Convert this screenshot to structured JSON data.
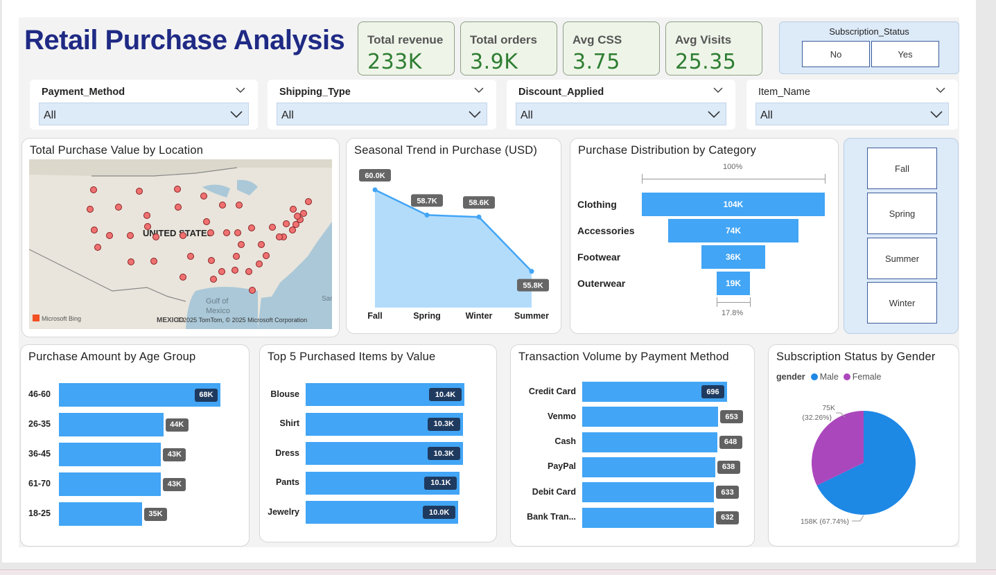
{
  "title": "Retail Purchase Analysis",
  "kpis": [
    {
      "label": "Total revenue",
      "value": "233K"
    },
    {
      "label": "Total orders",
      "value": "3.9K"
    },
    {
      "label": "Avg CSS",
      "value": "3.75"
    },
    {
      "label": "Avg Visits",
      "value": "25.35"
    }
  ],
  "subscription_slicer": {
    "header": "Subscription_Status",
    "options": [
      "No",
      "Yes"
    ]
  },
  "filters": [
    {
      "label": "Payment_Method",
      "value": "All",
      "bold": true
    },
    {
      "label": "Shipping_Type",
      "value": "All",
      "bold": true
    },
    {
      "label": "Discount_Applied",
      "value": "All",
      "bold": true
    },
    {
      "label": "Item_Name",
      "value": "All",
      "bold": false
    }
  ],
  "map": {
    "title": "Total Purchase Value by Location",
    "country_label": "UNITED STATES",
    "gulf_label": "Gulf of Mexico",
    "mexico_label": "MEXICO",
    "san_label": "Sar",
    "attribution": "© 2025 TomTom, © 2025 Microsoft Corporation",
    "bing_label": "Microsoft Bing",
    "colors": {
      "land": "#e9e5dc",
      "water": "#aac8d8",
      "marker": "#ef7171"
    }
  },
  "season_slicer": {
    "options": [
      "Fall",
      "Spring",
      "Summer",
      "Winter"
    ]
  },
  "colors": {
    "accent": "#42a5f5",
    "title": "#1f2a85",
    "kpi_value": "#2e7d32",
    "female": "#ab47bc",
    "male": "#1e88e5"
  },
  "chart_data": [
    {
      "type": "area",
      "title": "Seasonal Trend in Purchase (USD)",
      "categories": [
        "Fall",
        "Spring",
        "Winter",
        "Summer"
      ],
      "values": [
        60.0,
        58.7,
        58.6,
        55.8
      ],
      "labels": [
        "60.0K",
        "58.7K",
        "58.6K",
        "55.8K"
      ],
      "unit": "K"
    },
    {
      "type": "bar",
      "subtype": "funnel",
      "title": "Purchase Distribution by Category",
      "categories": [
        "Clothing",
        "Accessories",
        "Footwear",
        "Outerwear"
      ],
      "values": [
        104,
        74,
        36,
        19
      ],
      "labels": [
        "104K",
        "74K",
        "36K",
        "19K"
      ],
      "top_pct": "100%",
      "bottom_pct": "17.8%"
    },
    {
      "type": "bar",
      "title": "Purchase Amount by Age Group",
      "categories": [
        "46-60",
        "26-35",
        "36-45",
        "61-70",
        "18-25"
      ],
      "values": [
        68,
        44,
        43,
        43,
        35
      ],
      "labels": [
        "68K",
        "44K",
        "43K",
        "43K",
        "35K"
      ]
    },
    {
      "type": "bar",
      "title": "Top 5 Purchased Items by Value",
      "categories": [
        "Blouse",
        "Shirt",
        "Dress",
        "Pants",
        "Jewelry"
      ],
      "values": [
        10.4,
        10.3,
        10.3,
        10.1,
        10.0
      ],
      "labels": [
        "10.4K",
        "10.3K",
        "10.3K",
        "10.1K",
        "10.0K"
      ]
    },
    {
      "type": "bar",
      "title": "Transaction Volume by Payment Method",
      "categories": [
        "Credit Card",
        "Venmo",
        "Cash",
        "PayPal",
        "Debit Card",
        "Bank Tran..."
      ],
      "values": [
        696,
        653,
        648,
        638,
        633,
        632
      ],
      "labels": [
        "696",
        "653",
        "648",
        "638",
        "633",
        "632"
      ]
    },
    {
      "type": "pie",
      "title": "Subscription Status by Gender",
      "legend_title": "gender",
      "categories": [
        "Male",
        "Female"
      ],
      "values": [
        158,
        75
      ],
      "labels": [
        "158K (67.74%)",
        "75K (32.26%)"
      ],
      "percent": [
        67.74,
        32.26
      ]
    }
  ]
}
